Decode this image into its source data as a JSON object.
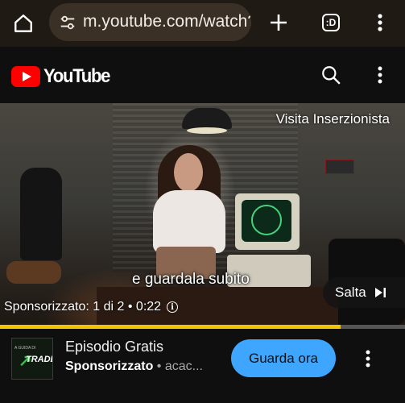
{
  "browser": {
    "url": "m.youtube.com/watch?v",
    "tab_count": ":D"
  },
  "header": {
    "logo_text": "YouTube"
  },
  "video": {
    "advertiser_link": "Visita Inserzionista",
    "caption": "e guardala subito",
    "skip_label": "Salta",
    "ad_status": "Sponsorizzato: 1 di 2 • 0:22",
    "progress": 0.84
  },
  "ad_card": {
    "thumbnail_top_text": "A GUIDA DI",
    "thumbnail_text": "TRADER",
    "title": "Episodio Gratis",
    "sponsor_label": "Sponsorizzato",
    "domain": " • acac...",
    "cta_label": "Guarda ora"
  },
  "colors": {
    "accent_blue": "#3ea6ff",
    "progress_yellow": "#f2c300",
    "youtube_red": "#ff0000"
  }
}
